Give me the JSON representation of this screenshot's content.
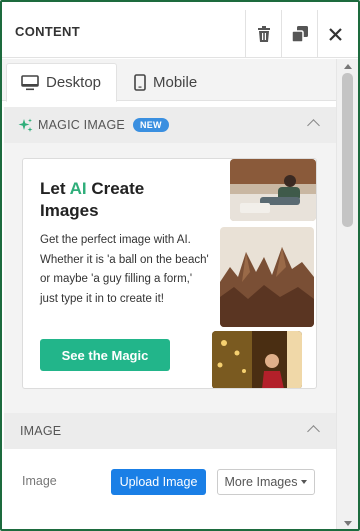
{
  "header": {
    "title": "CONTENT",
    "actions": [
      "trash-icon",
      "duplicate-icon",
      "close-icon"
    ]
  },
  "tabs": [
    {
      "label": "Desktop",
      "icon": "desktop-icon",
      "active": true
    },
    {
      "label": "Mobile",
      "icon": "mobile-icon",
      "active": false
    }
  ],
  "magic_image": {
    "heading": "MAGIC IMAGE",
    "badge": "NEW",
    "icon": "sparkle-icon",
    "card": {
      "title_pre": "Let ",
      "title_ai": "AI",
      "title_post": " Create Images",
      "text": "Get the perfect image with AI. Whether it is 'a ball on the beach' or maybe 'a guy filling a form,' just type it in to create it!",
      "button": "See the Magic"
    }
  },
  "image_section": {
    "heading": "IMAGE",
    "field_label": "Image",
    "upload_button": "Upload Image",
    "more_button": "More Images"
  },
  "colors": {
    "frame_border": "#1d6b3e",
    "accent_green": "#22b58a",
    "ai_text": "#2fae7a",
    "badge_blue": "#3a8fe0",
    "upload_blue": "#1a7fe6"
  }
}
